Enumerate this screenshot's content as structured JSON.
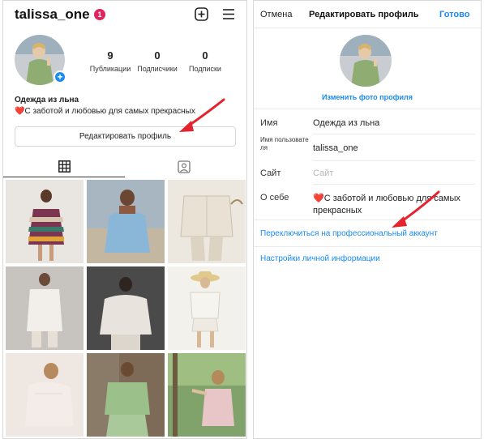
{
  "profile": {
    "username": "talissa_one",
    "notification_count": "1",
    "stats": [
      {
        "value": "9",
        "label": "Публикации"
      },
      {
        "value": "0",
        "label": "Подписчики"
      },
      {
        "value": "0",
        "label": "Подписки"
      }
    ],
    "name": "Одежда из льна",
    "bio_heart": "❤️",
    "bio": "С заботой и любовью для самых прекрасных",
    "edit_profile_label": "Редактировать профиль"
  },
  "edit_profile": {
    "cancel_label": "Отмена",
    "title": "Редактировать профиль",
    "done_label": "Готово",
    "change_photo_label": "Изменить фото профиля",
    "fields": {
      "name": {
        "label": "Имя",
        "value": "Одежда из льна"
      },
      "username": {
        "label": "Имя пользовате ля",
        "value": "talissa_one"
      },
      "website": {
        "label": "Сайт",
        "placeholder": "Сайт"
      },
      "bio": {
        "label": "О себе",
        "heart": "❤️",
        "value_line1": "С заботой и любовью для самых",
        "value_line2": "прекрасных"
      }
    },
    "switch_professional_label": "Переключиться на профессиональный аккаунт",
    "personal_info_label": "Настройки личной информации"
  },
  "colors": {
    "accent_blue": "#1a8af5",
    "arrow_red": "#e4232f",
    "badge_red": "#e0245e"
  }
}
